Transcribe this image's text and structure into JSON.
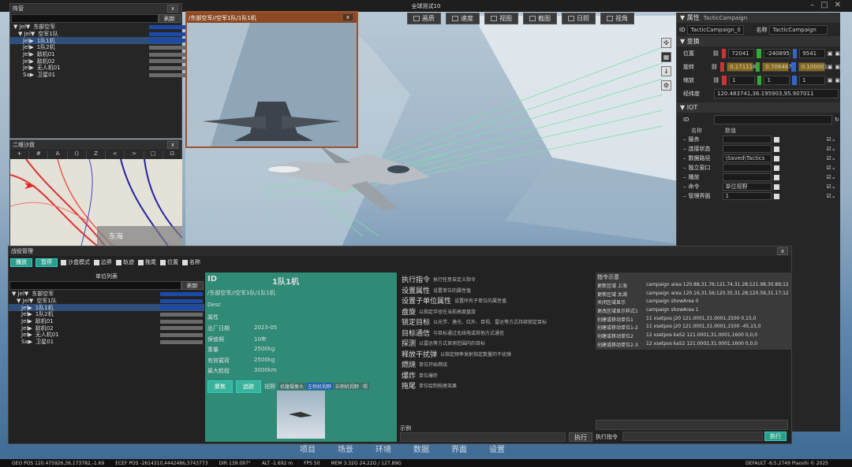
{
  "window": {
    "title": "全球测试10"
  },
  "toolbar": [
    {
      "icon": "image-icon",
      "label": "画质"
    },
    {
      "icon": "speed-icon",
      "label": "速度"
    },
    {
      "icon": "view-icon",
      "label": "视图"
    },
    {
      "icon": "screenshot-icon",
      "label": "截图"
    },
    {
      "icon": "daylight-icon",
      "label": "日照"
    },
    {
      "icon": "eye-icon",
      "label": "视角"
    }
  ],
  "camp": {
    "title": "阵营",
    "refresh": "刷新",
    "rows": [
      {
        "prefix": "▼ Jel▼",
        "name": "东部空军"
      },
      {
        "prefix": "▼ Jel▼",
        "name": "空军1队"
      },
      {
        "prefix": "Jel▶",
        "name": "1队1机"
      },
      {
        "prefix": "Jel▶",
        "name": "1队2机"
      },
      {
        "prefix": "Jel▶",
        "name": "敌机01"
      },
      {
        "prefix": "Jel▶",
        "name": "敌机02"
      },
      {
        "prefix": "Jel▶",
        "name": "无人机01"
      },
      {
        "prefix": "Sa▶",
        "name": "卫星01"
      }
    ]
  },
  "map2d": {
    "title": "二维沙盘",
    "tools": [
      "+",
      "#",
      "A",
      "()",
      "Z",
      "<",
      ">",
      "□",
      "⊡"
    ],
    "label": "东海"
  },
  "video": {
    "title": "/东部空军//空军1队/1队1机"
  },
  "properties": {
    "title": "属性",
    "type": "TacticCampaign",
    "id_label": "ID",
    "id_value": "TacticCampaign_0",
    "name_label": "名称",
    "name_value": "TacticCampaign",
    "transform": "变换",
    "position": {
      "label": "位置",
      "x": "72041",
      "y": "-240895",
      "z": "9541"
    },
    "rotation": {
      "label": "旋转",
      "x": "0.171118",
      "y": "0.706467",
      "z": "0.100001"
    },
    "scale": {
      "label": "缩放",
      "x": "1",
      "y": "1",
      "z": "1"
    },
    "lonlat": {
      "label": "经纬度",
      "value": "120.483741,36.195903,95.907011"
    },
    "iot": "IOT",
    "iot_id": "ID",
    "col_name": "名称",
    "col_value": "数值",
    "iot_rows": [
      {
        "name": "服务",
        "value": ""
      },
      {
        "name": "连接状态",
        "value": ""
      },
      {
        "name": "数据路径",
        "value": "\\Saved\\Tactics"
      },
      {
        "name": "独立窗口",
        "value": ""
      },
      {
        "name": "播放",
        "value": ""
      },
      {
        "name": "命令",
        "value": "单位视野"
      },
      {
        "name": "管理界面",
        "value": "1"
      }
    ]
  },
  "bottom": {
    "title": "战役管理",
    "btn_play": "播放",
    "btn_pause": "暂停",
    "checks": [
      "沙盒模式",
      "边界",
      "轨迹",
      "拖尾",
      "位置",
      "名称"
    ],
    "unit_list_title": "单位列表",
    "refresh": "刷新",
    "unit_rows": [
      {
        "prefix": "▼ Jel▼",
        "name": "东部空军"
      },
      {
        "prefix": "▼ Jel▼",
        "name": "空军1队"
      },
      {
        "prefix": "Jel▶",
        "name": "1队1机"
      },
      {
        "prefix": "Jel▶",
        "name": "1队2机"
      },
      {
        "prefix": "Jel▶",
        "name": "敌机01"
      },
      {
        "prefix": "Jel▶",
        "name": "敌机02"
      },
      {
        "prefix": "Jel▶",
        "name": "无人机01"
      },
      {
        "prefix": "Sa▶",
        "name": "卫星01"
      }
    ],
    "detail": {
      "id_label": "ID",
      "id_value": "1队1机",
      "path": "/东部空军//空军1队/1队1机",
      "desc": "Desc",
      "attr": "属性",
      "fields": [
        {
          "k": "出厂日期",
          "v": "2023-05"
        },
        {
          "k": "保值期",
          "v": "10年"
        },
        {
          "k": "重量",
          "v": "2500kg"
        },
        {
          "k": "有效载荷",
          "v": "2500kg"
        },
        {
          "k": "最大航程",
          "v": "3000km"
        }
      ],
      "btn_focus": "聚焦",
      "btn_track": "追踪",
      "view_label": "视野",
      "cams": [
        "机腹摄像头",
        "左侧机视野",
        "右侧机视野",
        "照"
      ]
    },
    "commands": [
      {
        "name": "执行指令",
        "desc": "执行任意自定义指令"
      },
      {
        "name": "设置属性",
        "desc": "设置单位的属性值"
      },
      {
        "name": "设置子单位属性",
        "desc": "设置所有子单位的属性值"
      },
      {
        "name": "盘旋",
        "desc": "以指定半径在当前高度盘旋"
      },
      {
        "name": "锁定目标",
        "desc": "以光学、激光、红外、目视、雷达等方式持续锁定目标"
      },
      {
        "name": "目标通信",
        "desc": "与目标通过无线电或其他方式通信"
      },
      {
        "name": "探测",
        "desc": "以雷达等方式探测范围内的目标"
      },
      {
        "name": "释放干扰弹",
        "desc": "以指定频率发射指定数量的干扰弹"
      },
      {
        "name": "燃烧",
        "desc": "单位开始燃烧"
      },
      {
        "name": "爆炸",
        "desc": "单位爆炸"
      },
      {
        "name": "拖尾",
        "desc": "单位绘制拖尾效果"
      }
    ],
    "example_label": "示例",
    "execute": "执行",
    "cmd_demo_title": "指令示意",
    "cmd_demo": [
      {
        "k": "更新区域 上海",
        "v": "campaign area 120.88,31.76;121.74,31.28;121.98,30.89;12"
      },
      {
        "k": "更新区域 太湖",
        "v": "campaign area 120.16,31.56;120.35,31.28;120.59,31.17;12"
      },
      {
        "k": "关闭区域显示",
        "v": "campaign showArea 0"
      },
      {
        "k": "更改区域显示样式1",
        "v": "campaign showArea 1"
      },
      {
        "k": "创建或移动单位1",
        "v": "11 xsetpos j20 121.0001,31.0001,1500 0,15,0"
      },
      {
        "k": "创建或移动单位1-2",
        "v": "11 xsetpos j20 121.0001,31.0001,1500 -45,15,0"
      },
      {
        "k": "创建或移动单位2",
        "v": "12 xsetpos ka52 121.0001,31.0001,1600 0,0,0"
      },
      {
        "k": "创建或移动单位2-3",
        "v": "12 xsetpos ka52 121.0002,31.0001,1600 0,0,0"
      }
    ],
    "exec_cmd_label": "执行指令",
    "exec_btn": "执行"
  },
  "tabs": [
    "项目",
    "场景",
    "环境",
    "数据",
    "界面",
    "设置"
  ],
  "status": {
    "geo": "GEO POS 120.475926,36.173782,-1.69",
    "ecef": "ECEF POS -2614310,4442486,3743773",
    "dir": "DIR 139.097°",
    "alt": "ALT -1.692 m",
    "fps": "FPS 50",
    "mem": "MEM 3.32G 24.22G / 127.89G",
    "right": "DEFAULT -6:5.2749 Piaoshi © 2025"
  },
  "colors": {
    "accent": "#2aa08a",
    "video_border": "#a0522d",
    "select": "#2f4e7a"
  }
}
